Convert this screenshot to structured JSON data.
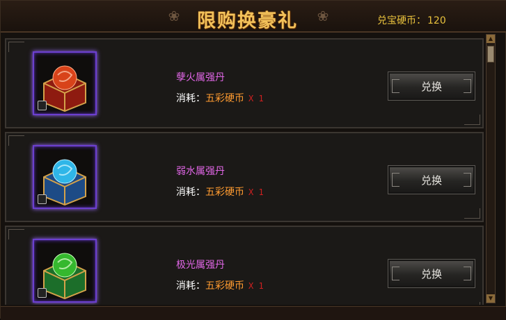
{
  "header": {
    "title": "限购换豪礼",
    "currency_label": "兑宝硬币：",
    "currency_value": "120"
  },
  "items": [
    {
      "name": "孽火属强丹",
      "cost_label": "消耗：",
      "currency": "五彩硬币",
      "qty": "X 1",
      "button": "兑换",
      "gem_color": "#d8431a"
    },
    {
      "name": "弱水属强丹",
      "cost_label": "消耗：",
      "currency": "五彩硬币",
      "qty": "X 1",
      "button": "兑换",
      "gem_color": "#2fb6e8"
    },
    {
      "name": "极光属强丹",
      "cost_label": "消耗：",
      "currency": "五彩硬币",
      "qty": "X 1",
      "button": "兑换",
      "gem_color": "#35b82e"
    }
  ],
  "colors": {
    "accent": "#f2c15a",
    "item_name": "#e066e6",
    "cost_currency": "#ff9b30",
    "qty": "#d02020"
  },
  "icons": [
    "scroll-up-arrow-icon",
    "scroll-down-arrow-icon",
    "lock-icon",
    "gift-box-icon"
  ]
}
